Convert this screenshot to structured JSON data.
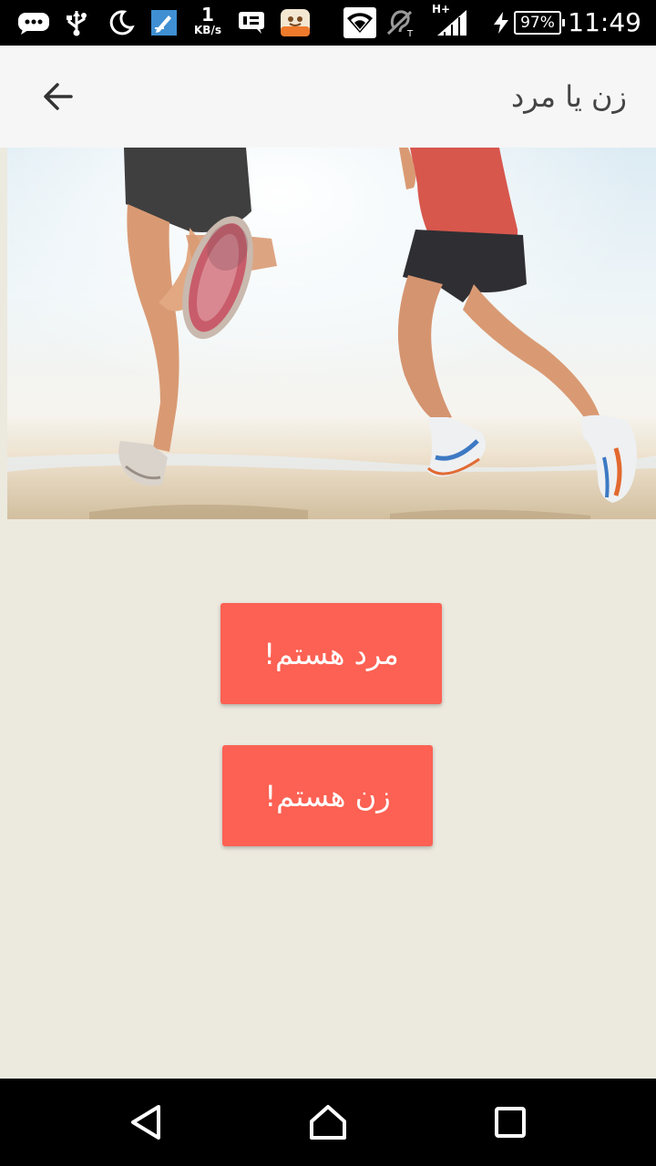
{
  "status_bar": {
    "network_speed_value": "1",
    "network_speed_unit": "KB/s",
    "network_type": "H+",
    "battery_level": "97%",
    "time": "11:49",
    "icons": [
      "chat-icon",
      "usb-icon",
      "moon-icon",
      "screenshot-icon",
      "message-icon",
      "app-icon",
      "wifi-icon",
      "hearing-aid-icon",
      "signal-icon",
      "charging-icon",
      "battery-icon"
    ]
  },
  "app_bar": {
    "title": "زن یا مرد",
    "back_icon": "arrow-left-icon"
  },
  "hero": {
    "icon": "runners-photo"
  },
  "buttons": {
    "male_label": "مرد هستم!",
    "female_label": "زن هستم!",
    "color": "#fc6153"
  },
  "nav_bar": {
    "icons": [
      "back-triangle-icon",
      "home-icon",
      "recents-icon"
    ]
  },
  "colors": {
    "background": "#ece9df",
    "app_bar": "#f6f6f6",
    "button": "#fc6153"
  }
}
